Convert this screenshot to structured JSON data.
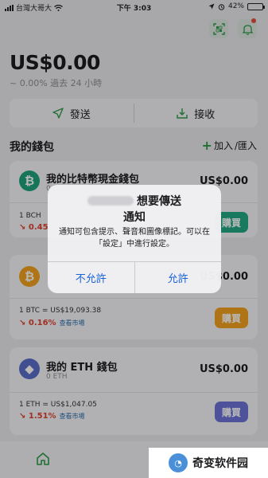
{
  "status_bar": {
    "carrier": "台灣大哥大",
    "time": "下午 3:03",
    "battery": "42%",
    "battery_level": 0.42
  },
  "wallet": {
    "balance": "US$0.00",
    "change_text": "~ 0.00% 過去 24 小時",
    "send_label": "發送",
    "receive_label": "接收",
    "section_title": "我的錢包",
    "add_label": "加入",
    "import_label": "/匯入"
  },
  "cards": [
    {
      "name": "我的比特幣現金錢包",
      "sub": "0 BCH",
      "value": "US$0.00",
      "coin_symbol": "₿",
      "coin_color": "#1fa37a",
      "price_line": "1 BCH",
      "change": "↘ 0.45",
      "market_link": "",
      "buy_label": "購買",
      "buy_color": "#22a884"
    },
    {
      "name": "",
      "sub": "",
      "value": "US$0.00",
      "coin_symbol": "₿",
      "coin_color": "#f2a11f",
      "price_line": "1 BTC = US$19,093.38",
      "change": "↘ 0.16%",
      "market_link": "查看市場",
      "buy_label": "購買",
      "buy_color": "#f2a11f"
    },
    {
      "name": "我的 ETH 錢包",
      "sub": "0 ETH",
      "value": "US$0.00",
      "coin_symbol": "◆",
      "coin_color": "#5b6dc8",
      "price_line": "1 ETH = US$1,047.05",
      "change": "↘ 1.51%",
      "market_link": "查看市場",
      "buy_label": "購買",
      "buy_color": "#6d72d6"
    }
  ],
  "alert": {
    "title_line1": "想要傳送",
    "title_line2": "通知",
    "message": "通知可包含提示、聲音和圖像標記。可以在「設定」中進行設定。",
    "deny_label": "不允許",
    "allow_label": "允許"
  },
  "watermark": {
    "text": "奇变软件园"
  },
  "colors": {
    "accent_green": "#2e9a4a",
    "alert_blue": "#1a63d6",
    "negative_red": "#e0402f"
  }
}
